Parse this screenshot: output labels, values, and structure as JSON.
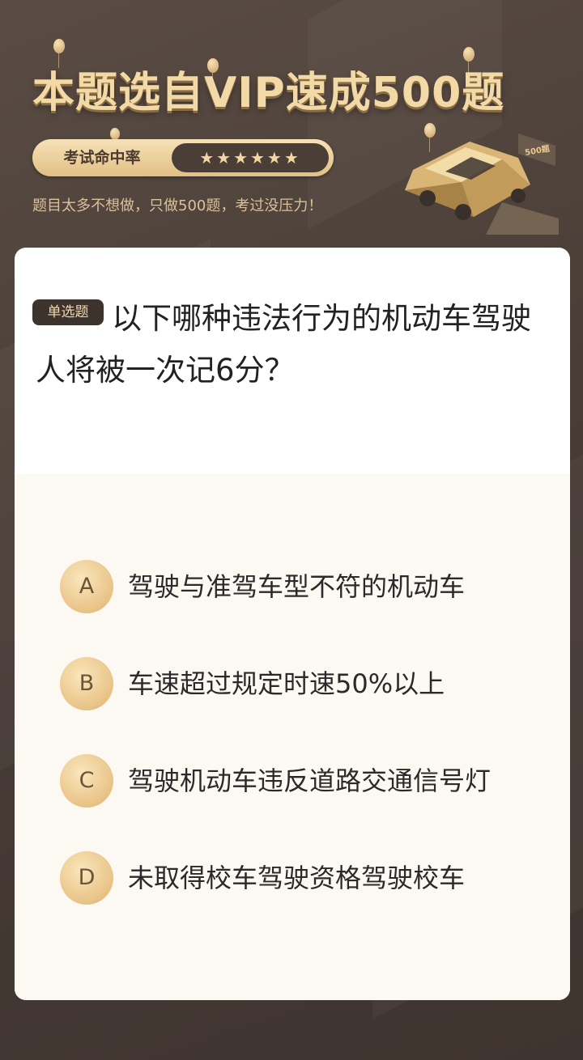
{
  "header": {
    "title": "本题选自VIP速成500题",
    "rate_label": "考试命中率",
    "rate_stars": "★★★★★★",
    "subtitle": "题目太多不想做，只做500题，考过没压力！",
    "car_badge": "500题"
  },
  "question": {
    "type_badge": "单选题",
    "text": "以下哪种违法行为的机动车驾驶人将被一次记6分？",
    "options": [
      {
        "letter": "A",
        "text": "驾驶与准驾车型不符的机动车"
      },
      {
        "letter": "B",
        "text": "车速超过规定时速50%以上"
      },
      {
        "letter": "C",
        "text": "驾驶机动车违反道路交通信号灯"
      },
      {
        "letter": "D",
        "text": "未取得校车驾驶资格驾驶校车"
      }
    ]
  },
  "colors": {
    "background": "#4a3f39",
    "gold": "#f2d9a6",
    "badge_bg": "#3d332d",
    "card": "#ffffff",
    "options_bg": "#fcf9f3"
  }
}
